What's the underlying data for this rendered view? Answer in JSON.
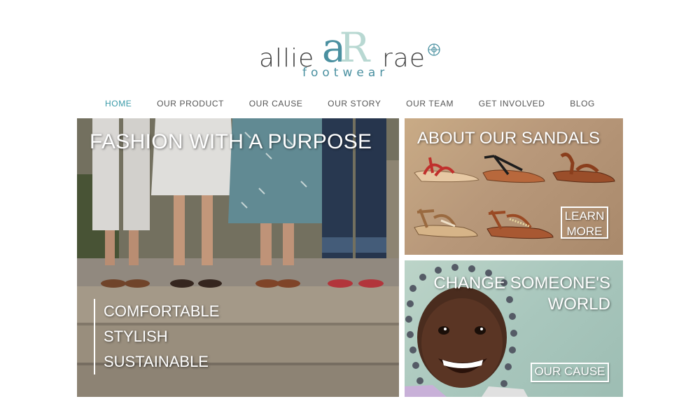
{
  "logo": {
    "word_left": "allie",
    "monogram": "aR",
    "word_right": "rae",
    "subtitle": "footwear",
    "globe_icon": "globe-icon",
    "colors": {
      "teal": "#4a90a0",
      "mint": "#b8d8d2",
      "gray": "#444444"
    }
  },
  "nav": {
    "items": [
      {
        "label": "HOME",
        "active": true
      },
      {
        "label": "OUR PRODUCT",
        "active": false
      },
      {
        "label": "OUR CAUSE",
        "active": false
      },
      {
        "label": "OUR STORY",
        "active": false
      },
      {
        "label": "OUR TEAM",
        "active": false
      },
      {
        "label": "GET INVOLVED",
        "active": false
      },
      {
        "label": "BLOG",
        "active": false
      }
    ],
    "active_color": "#3a9aa8"
  },
  "hero": {
    "headline": "FASHION WITH A PURPOSE",
    "taglines": [
      "COMFORTABLE",
      "STYLISH",
      "SUSTAINABLE"
    ]
  },
  "about": {
    "headline": "ABOUT OUR SANDALS",
    "button_line1": "LEARN",
    "button_line2": "MORE"
  },
  "cause": {
    "headline": "CHANGE SOMEONE'S WORLD",
    "button": "OUR CAUSE"
  }
}
